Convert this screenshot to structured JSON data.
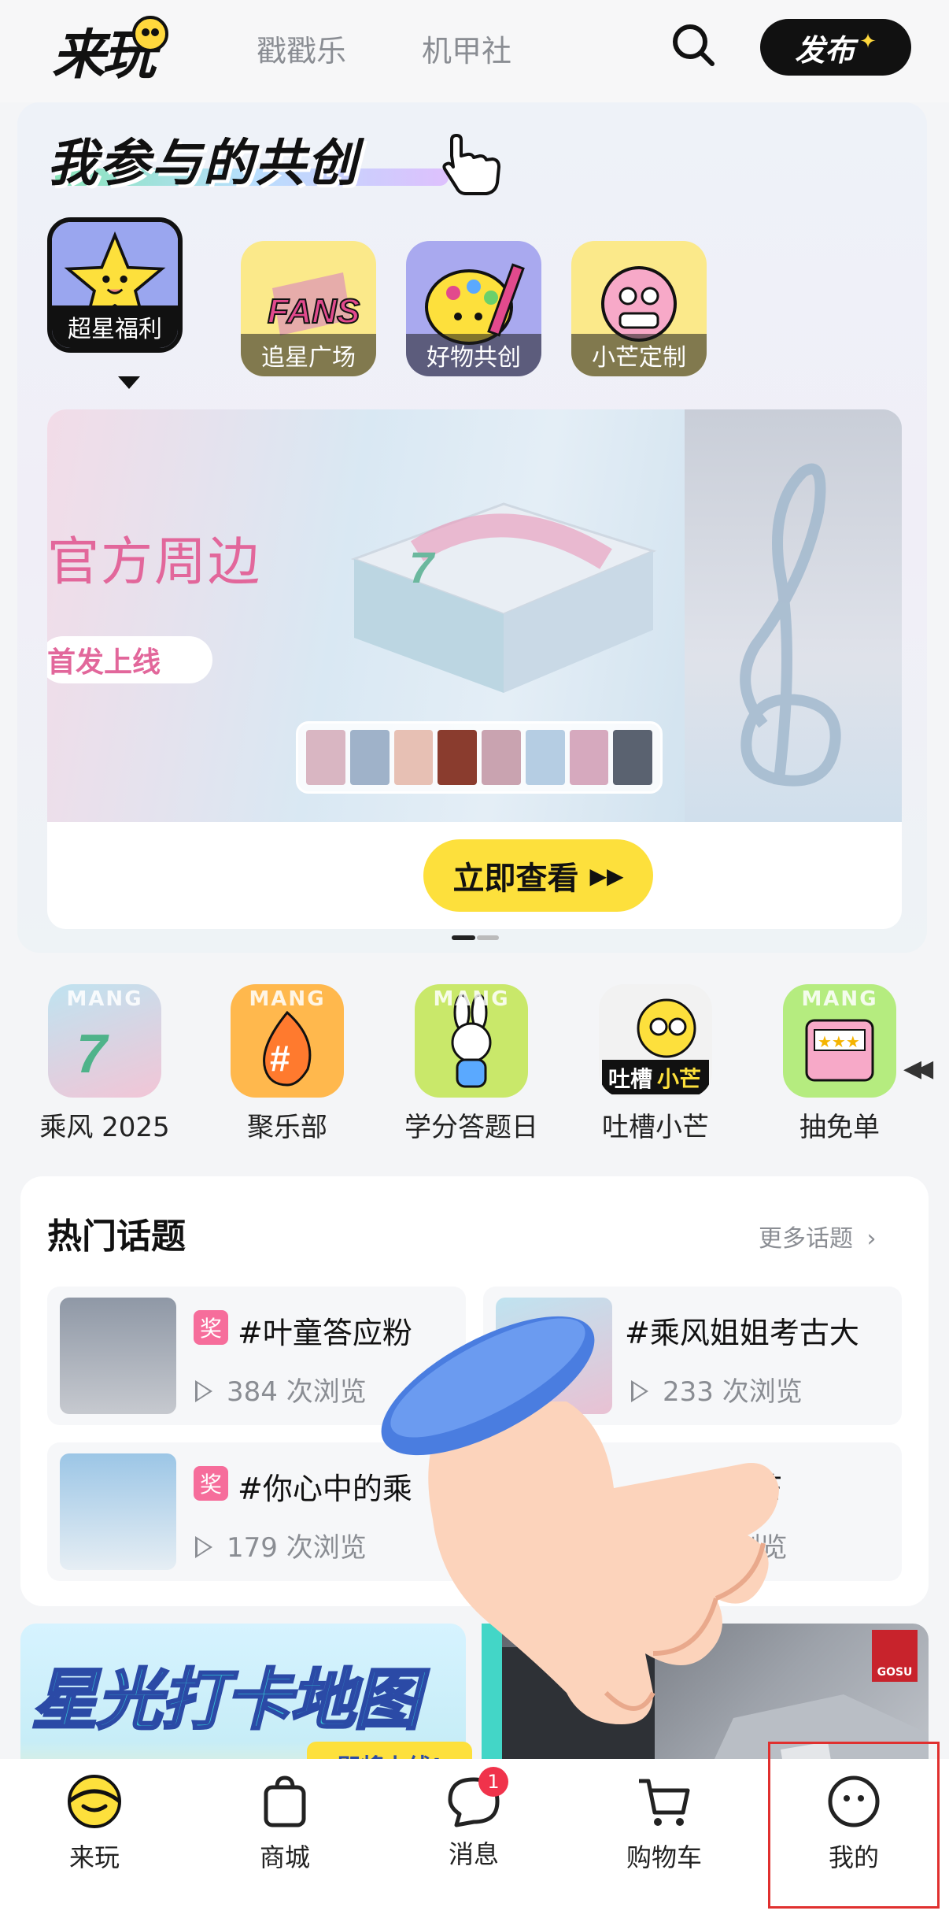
{
  "header": {
    "logo": "来玩",
    "tabs": [
      "戳戳乐",
      "机甲社"
    ],
    "publish_label": "发布"
  },
  "cocreate": {
    "title": "我参与的共创",
    "categories": [
      {
        "label": "超星福利",
        "icon": "star-mascot-icon",
        "active": true
      },
      {
        "label": "追星广场",
        "icon": "fans-icon",
        "active": false
      },
      {
        "label": "好物共创",
        "icon": "palette-icon",
        "active": false
      },
      {
        "label": "小芒定制",
        "icon": "diy-icon",
        "active": false
      }
    ],
    "banner": {
      "headline": "官方周边",
      "subline": "首发上线",
      "cta_label": "立即查看"
    }
  },
  "shortcuts": [
    {
      "label": "乘风 2025",
      "icon": "chengfeng-icon",
      "color": "#d9eef6"
    },
    {
      "label": "聚乐部",
      "icon": "hashtag-fire-icon",
      "color": "#ffb84d"
    },
    {
      "label": "学分答题日",
      "icon": "bunny-icon",
      "color": "#c9e86a"
    },
    {
      "label": "吐槽小芒",
      "icon": "xiaomang-laptop-icon",
      "color": "#fde03c"
    },
    {
      "label": "抽免单",
      "icon": "slot-machine-icon",
      "color": "#b5ec7f"
    }
  ],
  "hot_topics": {
    "title": "热门话题",
    "more_label": "更多话题",
    "items": [
      {
        "title": "#叶童答应粉",
        "views": "384 次浏览",
        "tag": "奖",
        "has_tag": true
      },
      {
        "title": "#乘风姐姐考古大",
        "views": "233 次浏览",
        "tag": "",
        "has_tag": false
      },
      {
        "title": "#你心中的乘",
        "views": "179 次浏览",
        "tag": "奖",
        "has_tag": true
      },
      {
        "title": "芒",
        "views": "w 次浏览",
        "tag": "",
        "has_tag": false
      }
    ]
  },
  "promos": {
    "left_title": "星光打卡地图",
    "left_sub": "即将上线!",
    "right_brand": "GOSU"
  },
  "tabbar": {
    "items": [
      {
        "label": "来玩",
        "icon": "laiwan-face-icon",
        "active": true
      },
      {
        "label": "商城",
        "icon": "bag-icon",
        "active": false
      },
      {
        "label": "消息",
        "icon": "chat-bubble-icon",
        "active": false,
        "badge": "1"
      },
      {
        "label": "购物车",
        "icon": "cart-icon",
        "active": false
      },
      {
        "label": "我的",
        "icon": "profile-face-icon",
        "active": false
      }
    ]
  },
  "colors": {
    "accent_yellow": "#fde03c",
    "badge_red": "#f0334b",
    "tag_pink": "#f66d9b",
    "highlight_red": "#e0302f"
  }
}
